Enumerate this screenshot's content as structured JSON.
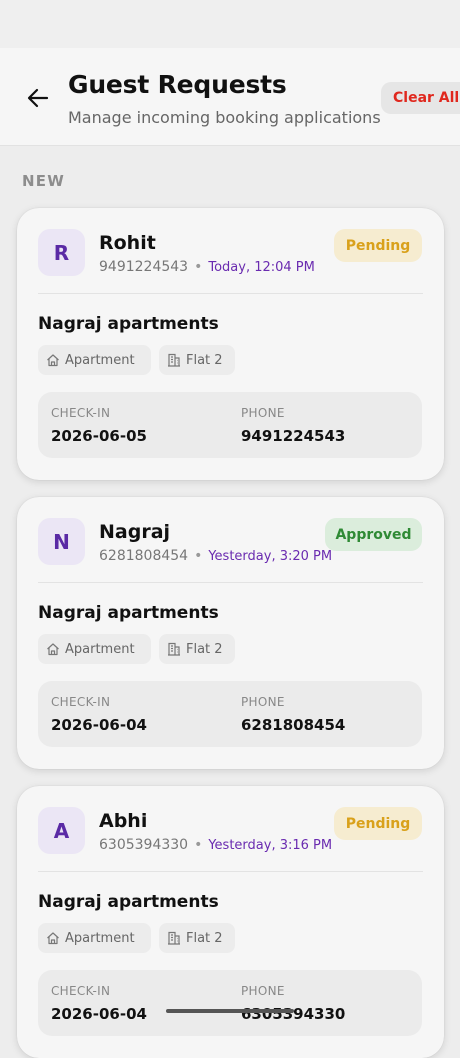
{
  "header": {
    "title": "Guest Requests",
    "subtitle": "Manage incoming booking applications",
    "clear_label": "Clear All"
  },
  "section_label": "NEW",
  "labels": {
    "checkin": "CHECK-IN",
    "phone": "PHONE"
  },
  "colors": {
    "accent": "#5a2aa5",
    "pending": "#d9a11b",
    "approved": "#2f8a35",
    "danger": "#e0281e"
  },
  "requests": [
    {
      "initial": "R",
      "name": "Rohit",
      "phone": "9491224543",
      "time": "Today, 12:04 PM",
      "status": "Pending",
      "property": "Nagraj apartments",
      "type": "Apartment",
      "unit": "Flat 2",
      "checkin": "2026-06-05"
    },
    {
      "initial": "N",
      "name": "Nagraj",
      "phone": "6281808454",
      "time": "Yesterday, 3:20 PM",
      "status": "Approved",
      "property": "Nagraj apartments",
      "type": "Apartment",
      "unit": "Flat 2",
      "checkin": "2026-06-04"
    },
    {
      "initial": "A",
      "name": "Abhi",
      "phone": "6305394330",
      "time": "Yesterday, 3:16 PM",
      "status": "Pending",
      "property": "Nagraj apartments",
      "type": "Apartment",
      "unit": "Flat 2",
      "checkin": "2026-06-04"
    }
  ]
}
